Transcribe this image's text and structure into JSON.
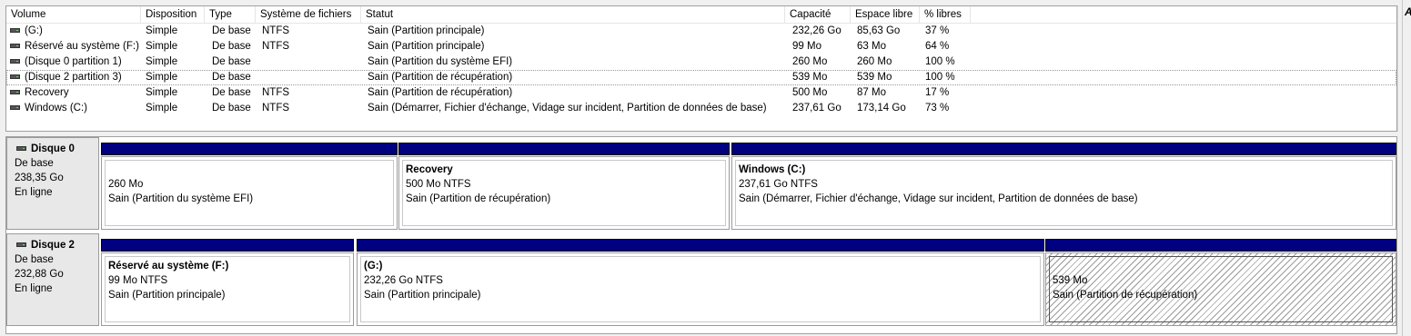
{
  "list": {
    "columns": [
      "Volume",
      "Disposition",
      "Type",
      "Système de fichiers",
      "Statut",
      "Capacité",
      "Espace libre",
      "% libres"
    ],
    "rows": [
      [
        "(G:)",
        "Simple",
        "De base",
        "NTFS",
        "Sain (Partition principale)",
        "232,26 Go",
        "85,63 Go",
        "37 %"
      ],
      [
        "Réservé au système (F:)",
        "Simple",
        "De base",
        "NTFS",
        "Sain (Partition principale)",
        "99 Mo",
        "63 Mo",
        "64 %"
      ],
      [
        "(Disque 0 partition 1)",
        "Simple",
        "De base",
        "",
        "Sain (Partition du système EFI)",
        "260 Mo",
        "260 Mo",
        "100 %"
      ],
      [
        "(Disque 2 partition 3)",
        "Simple",
        "De base",
        "",
        "Sain (Partition de récupération)",
        "539 Mo",
        "539 Mo",
        "100 %"
      ],
      [
        "Recovery",
        "Simple",
        "De base",
        "NTFS",
        "Sain (Partition de récupération)",
        "500 Mo",
        "87 Mo",
        "17 %"
      ],
      [
        "Windows (C:)",
        "Simple",
        "De base",
        "NTFS",
        "Sain (Démarrer, Fichier d'échange, Vidage sur incident, Partition de données de base)",
        "237,61 Go",
        "173,14 Go",
        "73 %"
      ]
    ],
    "selected_row": 3
  },
  "right_edge_char": "A",
  "disks": [
    {
      "name": "Disque 0",
      "type": "De base",
      "size": "238,35 Go",
      "state": "En ligne",
      "partitions": [
        {
          "name": "",
          "size": "260 Mo",
          "status": "Sain (Partition du système EFI)"
        },
        {
          "name": "Recovery",
          "size": "500 Mo NTFS",
          "status": "Sain (Partition de récupération)"
        },
        {
          "name": "Windows  (C:)",
          "size": "237,61 Go NTFS",
          "status": "Sain (Démarrer, Fichier d'échange, Vidage sur incident, Partition de données de base)"
        }
      ]
    },
    {
      "name": "Disque 2",
      "type": "De base",
      "size": "232,88 Go",
      "state": "En ligne",
      "partitions": [
        {
          "name": "Réservé au système  (F:)",
          "size": "99 Mo NTFS",
          "status": "Sain (Partition principale)"
        },
        {
          "name": "(G:)",
          "size": "232,26 Go NTFS",
          "status": "Sain (Partition principale)"
        },
        {
          "name": "",
          "size": "539 Mo",
          "status": "Sain (Partition de récupération)"
        }
      ]
    }
  ],
  "colors": {
    "partition_bar": "#000080",
    "selection": "#cce8ff",
    "background": "#f0f0f0"
  }
}
